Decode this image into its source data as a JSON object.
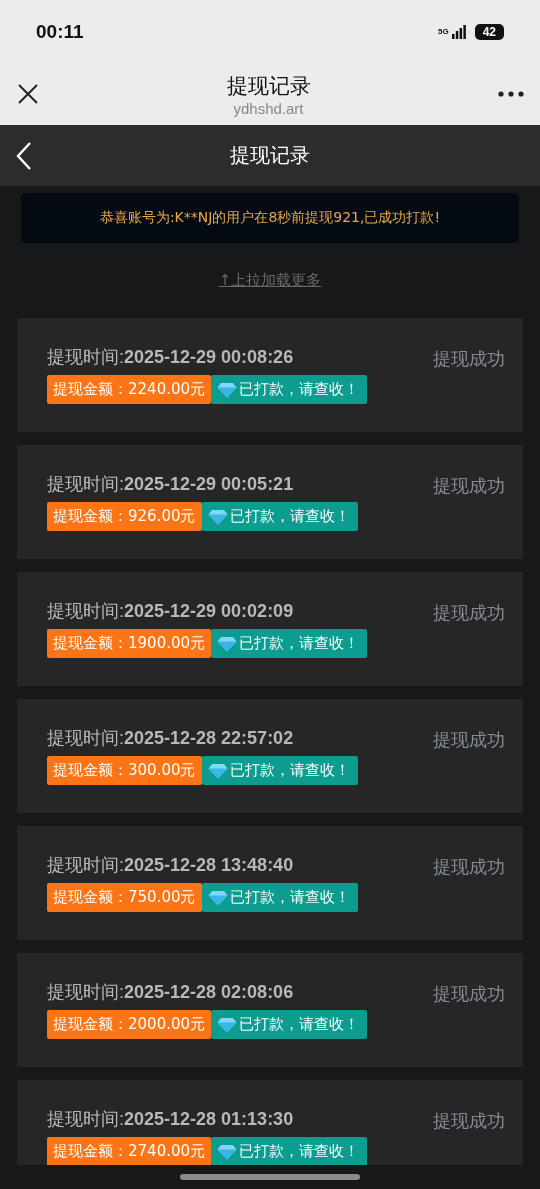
{
  "status_bar": {
    "time": "00:11",
    "network": "5G",
    "battery": "42"
  },
  "browser": {
    "title": "提现记录",
    "domain": "ydhshd.art"
  },
  "header": {
    "title": "提现记录"
  },
  "notice": "恭喜账号为:K**NJ的用户在8秒前提现921,已成功打款!",
  "load_more": "↑上拉加载更多",
  "records": [
    {
      "time": "提现时间:**2025-12-29 00:08:26**",
      "amount": "提现金额：2240.00元",
      "paid": "已打款，请查收！",
      "status": "提现成功"
    },
    {
      "time": "提现时间:**2025-12-29 00:05:21**",
      "amount": "提现金额：926.00元",
      "paid": "已打款，请查收！",
      "status": "提现成功"
    },
    {
      "time": "提现时间:**2025-12-29 00:02:09**",
      "amount": "提现金额：1900.00元",
      "paid": "已打款，请查收！",
      "status": "提现成功"
    },
    {
      "time": "提现时间:**2025-12-28 22:57:02**",
      "amount": "提现金额：300.00元",
      "paid": "已打款，请查收！",
      "status": "提现成功"
    },
    {
      "time": "提现时间:**2025-12-28 13:48:40**",
      "amount": "提现金额：750.00元",
      "paid": "已打款，请查收！",
      "status": "提现成功"
    },
    {
      "time": "提现时间:**2025-12-28 02:08:06**",
      "amount": "提现金额：2000.00元",
      "paid": "已打款，请查收！",
      "status": "提现成功"
    },
    {
      "time": "提现时间:**2025-12-28 01:13:30**",
      "amount": "提现金额：2740.00元",
      "paid": "已打款，请查收！",
      "status": "提现成功"
    }
  ]
}
